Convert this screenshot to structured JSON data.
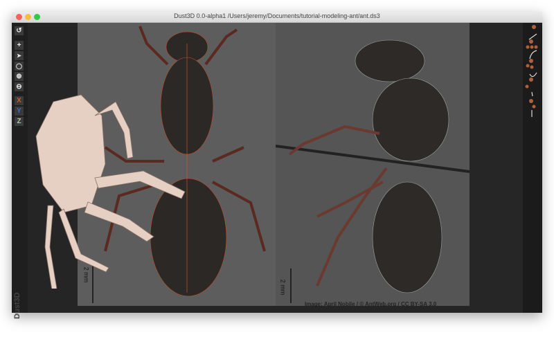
{
  "window": {
    "title": "Dust3D 0.0-alpha1 /Users/jeremy/Documents/tutorial-modeling-ant/ant.ds3"
  },
  "toolbar": {
    "undo_icon": "↺",
    "add_icon": "+",
    "select_icon": "➤",
    "lasso_icon": "◯",
    "zoom_in_icon": "⊕",
    "zoom_out_icon": "⊖",
    "x_label": "X",
    "y_label": "Y",
    "z_label": "Z",
    "x_color": "#c8612b",
    "y_color": "#3d6fb0",
    "z_color": "#4a8a6a"
  },
  "brand": "Dust3D",
  "scale_left": "2 mm",
  "scale_right": "2 mm",
  "credit": "Image: April Nobile / © AntWeb.org / CC BY-SA 3.0"
}
